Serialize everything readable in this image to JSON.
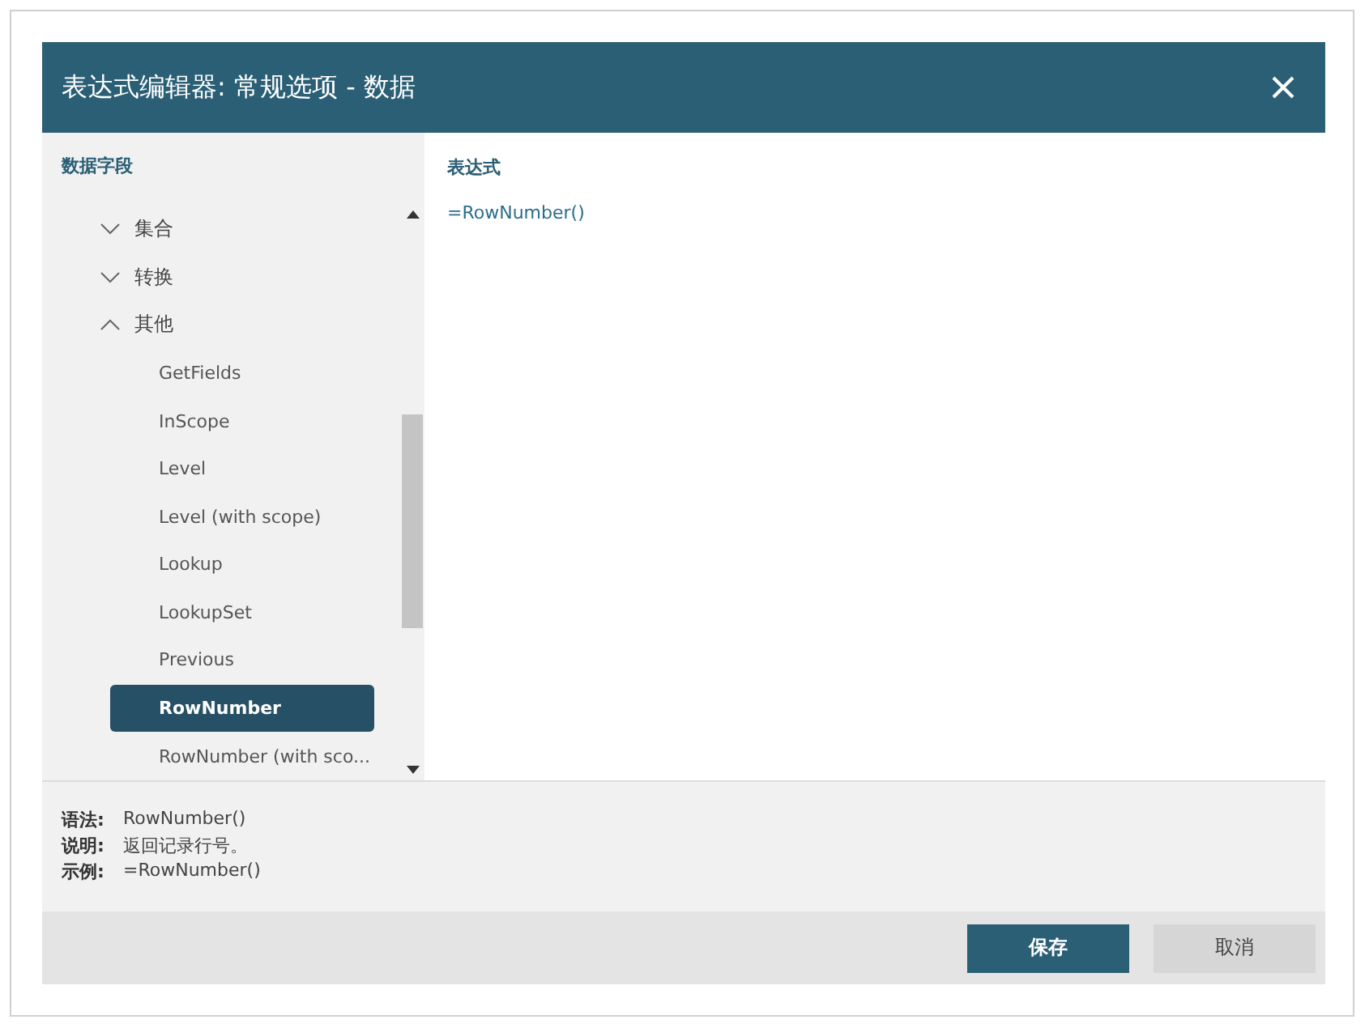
{
  "dialog": {
    "title": "表达式编辑器: 常规选项 - 数据"
  },
  "fields_panel": {
    "title": "数据字段",
    "tree": [
      {
        "label": "集合",
        "expanded": false,
        "selected": false
      },
      {
        "label": "转换",
        "expanded": false,
        "selected": false
      },
      {
        "label": "其他",
        "expanded": true,
        "selected": false,
        "children": [
          {
            "label": "GetFields",
            "selected": false
          },
          {
            "label": "InScope",
            "selected": false
          },
          {
            "label": "Level",
            "selected": false
          },
          {
            "label": "Level (with scope)",
            "selected": false
          },
          {
            "label": "Lookup",
            "selected": false
          },
          {
            "label": "LookupSet",
            "selected": false
          },
          {
            "label": "Previous",
            "selected": false
          },
          {
            "label": "RowNumber",
            "selected": true
          },
          {
            "label": "RowNumber (with sco...",
            "selected": false
          }
        ]
      }
    ]
  },
  "expression": {
    "title": "表达式",
    "value": "=RowNumber()"
  },
  "info": [
    {
      "label": "语法:",
      "value": "RowNumber()"
    },
    {
      "label": "说明:",
      "value": "返回记录行号。"
    },
    {
      "label": "示例:",
      "value": "=RowNumber()"
    }
  ],
  "buttons": [
    {
      "label": "保存",
      "kind": "primary"
    },
    {
      "label": "取消",
      "kind": "secondary"
    }
  ]
}
